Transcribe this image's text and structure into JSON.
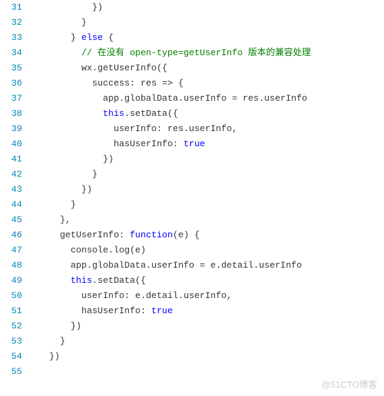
{
  "line_numbers": [
    "31",
    "32",
    "33",
    "34",
    "35",
    "36",
    "37",
    "38",
    "39",
    "40",
    "41",
    "42",
    "43",
    "44",
    "45",
    "46",
    "47",
    "48",
    "49",
    "50",
    "51",
    "52",
    "53",
    "54",
    "55"
  ],
  "code": {
    "l31": {
      "indent": "            ",
      "t1": "})"
    },
    "l32": {
      "indent": "          ",
      "t1": "}"
    },
    "l33": {
      "indent": "        ",
      "t1": "} ",
      "kw": "else",
      "t2": " {"
    },
    "l34": {
      "indent": "          ",
      "comment": "// 在没有 open-type=getUserInfo 版本的兼容处理"
    },
    "l35": {
      "indent": "          ",
      "t1": "wx.getUserInfo({"
    },
    "l36": {
      "indent": "            ",
      "t1": "success: res => {"
    },
    "l37": {
      "indent": "              ",
      "t1": "app.globalData.userInfo = res.userInfo"
    },
    "l38": {
      "indent": "              ",
      "kw": "this",
      "t1": ".setData({"
    },
    "l39": {
      "indent": "                ",
      "t1": "userInfo: res.userInfo,"
    },
    "l40": {
      "indent": "                ",
      "t1": "hasUserInfo: ",
      "kw": "true"
    },
    "l41": {
      "indent": "              ",
      "t1": "})"
    },
    "l42": {
      "indent": "            ",
      "t1": "}"
    },
    "l43": {
      "indent": "          ",
      "t1": "})"
    },
    "l44": {
      "indent": "        ",
      "t1": "}"
    },
    "l45": {
      "indent": "      ",
      "t1": "},"
    },
    "l46": {
      "indent": "      ",
      "t1": "getUserInfo: ",
      "kw": "function",
      "t2": "(e) {"
    },
    "l47": {
      "indent": "        ",
      "t1": "console.log(e)"
    },
    "l48": {
      "indent": "        ",
      "t1": "app.globalData.userInfo = e.detail.userInfo"
    },
    "l49": {
      "indent": "        ",
      "kw": "this",
      "t1": ".setData({"
    },
    "l50": {
      "indent": "          ",
      "t1": "userInfo: e.detail.userInfo,"
    },
    "l51": {
      "indent": "          ",
      "t1": "hasUserInfo: ",
      "kw": "true"
    },
    "l52": {
      "indent": "        ",
      "t1": "})"
    },
    "l53": {
      "indent": "      ",
      "t1": "}"
    },
    "l54": {
      "indent": "    ",
      "t1": "})"
    },
    "l55": {
      "indent": "",
      "t1": ""
    }
  },
  "watermark": "@51CTO博客"
}
